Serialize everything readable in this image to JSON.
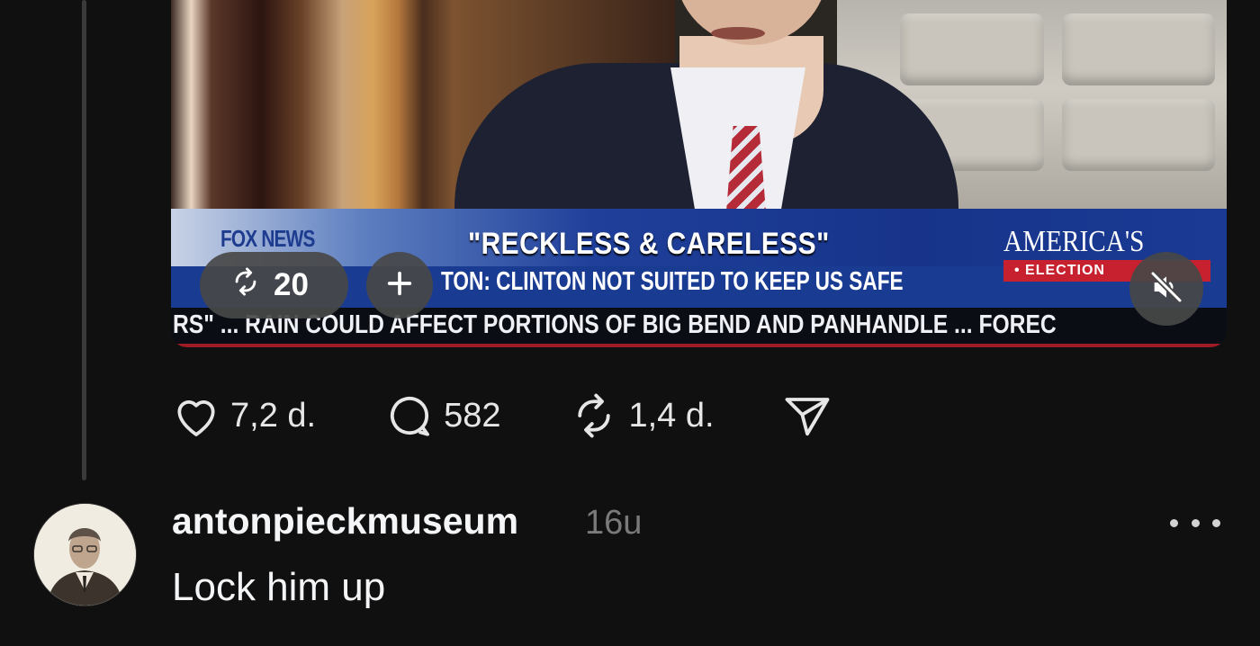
{
  "video": {
    "channel_logo": "FOX NEWS",
    "headline": "\"RECKLESS & CARELESS\"",
    "subheadline": "TON: CLINTON NOT SUITED TO KEEP US SAFE",
    "election_brand": "AMERICA'S",
    "election_tag": "• ELECTION",
    "ticker": "RS\" ... RAIN COULD AFFECT PORTIONS OF BIG BEND AND PANHANDLE ... FOREC",
    "repost_count": "20",
    "add_icon": "plus-icon",
    "mute_icon": "speaker-muted-icon"
  },
  "actions": {
    "likes": "7,2 d.",
    "comments": "582",
    "reposts": "1,4 d.",
    "icons": [
      "heart-icon",
      "comment-icon",
      "repost-icon",
      "send-icon"
    ]
  },
  "reply": {
    "username": "antonpieckmuseum",
    "time": "16u",
    "text": "Lock him up",
    "more_icon": "more-icon"
  },
  "colors": {
    "background": "#101010",
    "text": "#f3f5f7",
    "muted": "#7a7a7a",
    "chip": "#484848"
  }
}
